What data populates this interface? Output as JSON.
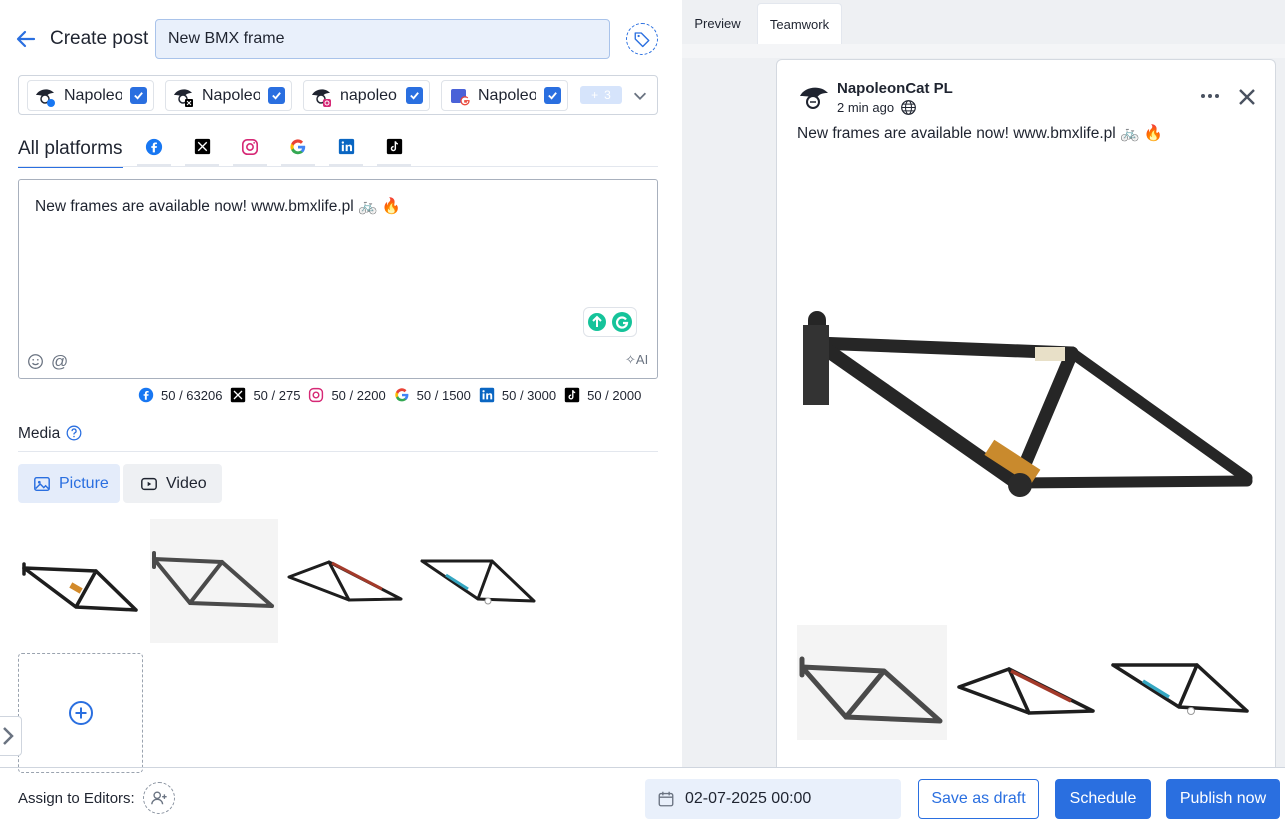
{
  "header": {
    "title": "Create post",
    "post_name_value": "New BMX frame",
    "back_icon": "arrow-left-icon",
    "tag_icon": "tag-icon"
  },
  "profiles": {
    "items": [
      {
        "label": "Napoleo",
        "network": "facebook",
        "checked": true
      },
      {
        "label": "Napoleo",
        "network": "x",
        "checked": true
      },
      {
        "label": "napoleo",
        "network": "instagram",
        "checked": true
      },
      {
        "label": "Napoleo",
        "network": "google",
        "checked": true
      }
    ],
    "more_count": "3"
  },
  "platform_tabs": {
    "all": "All platforms",
    "icons": [
      "facebook-icon",
      "x-icon",
      "instagram-icon",
      "google-icon",
      "linkedin-icon",
      "tiktok-icon"
    ]
  },
  "editor": {
    "text": "New frames are available now! www.bmxlife.pl 🚲 🔥",
    "mention": "@",
    "ai_label": "AI"
  },
  "counters": [
    {
      "network": "facebook",
      "text": "50 / 63206"
    },
    {
      "network": "x",
      "text": "50 / 275"
    },
    {
      "network": "instagram",
      "text": "50 / 2200"
    },
    {
      "network": "google",
      "text": "50 / 1500"
    },
    {
      "network": "linkedin",
      "text": "50 / 3000"
    },
    {
      "network": "tiktok",
      "text": "50 / 2000"
    }
  ],
  "media": {
    "label": "Media",
    "picture": "Picture",
    "video": "Video"
  },
  "preview": {
    "tabs": [
      "Preview",
      "Teamwork"
    ],
    "account_name": "NapoleonCat PL",
    "time": "2 min ago",
    "text": "New frames are available now! www.bmxlife.pl 🚲 🔥"
  },
  "footer": {
    "assign_label": "Assign to Editors:",
    "date": "02-07-2025 00:00",
    "save_draft": "Save as draft",
    "schedule": "Schedule",
    "publish": "Publish now"
  },
  "colors": {
    "accent": "#2a6fe0",
    "panel_bg": "#eef0f3",
    "input_bg": "#e9f0fb"
  }
}
